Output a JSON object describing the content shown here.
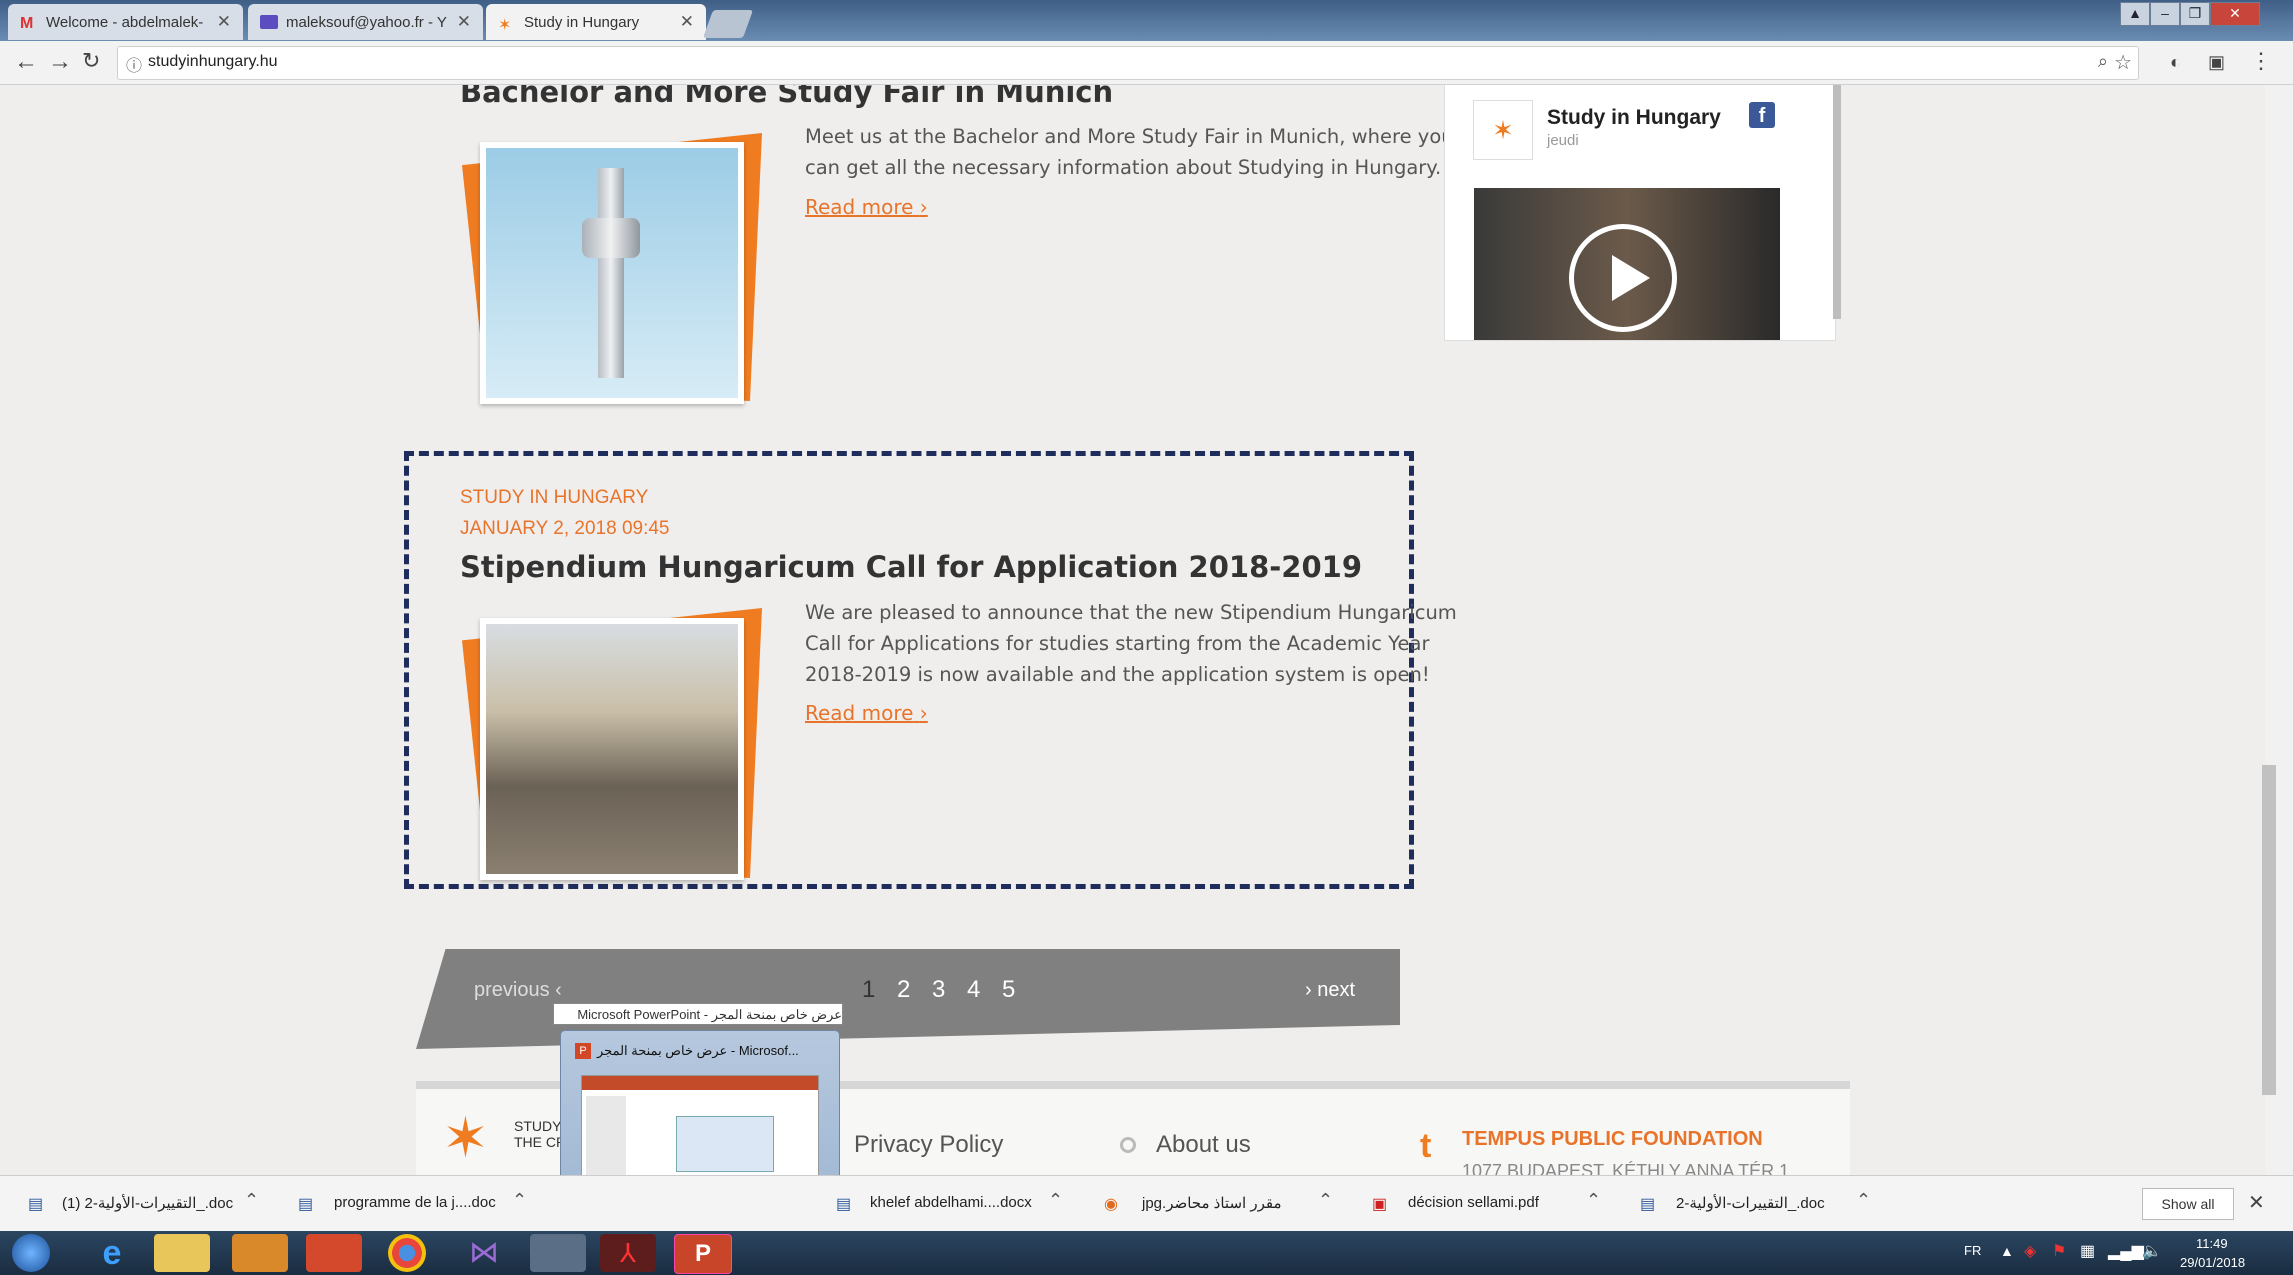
{
  "browser": {
    "tabs": [
      {
        "label": "Welcome - abdelmalek-",
        "icon": "gmail-icon"
      },
      {
        "label": "maleksouf@yahoo.fr - Y",
        "icon": "yahoo-mail-icon"
      },
      {
        "label": "Study in Hungary",
        "icon": "site-icon"
      }
    ],
    "url": "studyinhungary.hu"
  },
  "articles": [
    {
      "title": "Bachelor and More Study Fair in Munich",
      "excerpt_lines": [
        "Meet us at the Bachelor and More Study Fair in Munich, where you",
        "can get all the necessary information about Studying in Hungary."
      ],
      "read_more": "Read more"
    },
    {
      "category": "STUDY IN HUNGARY",
      "date": "JANUARY 2, 2018 09:45",
      "title": "Stipendium Hungaricum Call for Application 2018-2019",
      "excerpt_lines": [
        "We are pleased to announce that the new Stipendium Hungaricum",
        "Call for Applications for studies starting from the Academic Year",
        "2018-2019 is now available and the application system is open!"
      ],
      "read_more": "Read more"
    }
  ],
  "facebook_widget": {
    "page_name": "Study in Hungary",
    "subtitle": "jeudi"
  },
  "pagination": {
    "previous": "previous",
    "next": "next",
    "pages": [
      "1",
      "2",
      "3",
      "4",
      "5"
    ]
  },
  "footer": {
    "privacy": "Privacy Policy",
    "about": "About us",
    "logo_text_1": "STUDY",
    "logo_text_2": "THE CR",
    "tempus_title": "TEMPUS PUBLIC FOUNDATION",
    "tempus_address": "1077 BUDAPEST, KÉTHLY ANNA TÉR 1"
  },
  "thumbnail_popup": {
    "tooltip": "عرض خاص بمنحة المجر - Microsoft PowerPoint",
    "title": "عرض خاص بمنحة المجر - Microsof..."
  },
  "downloads": [
    {
      "name": "(1) التقييرات-الأولية-2_.doc"
    },
    {
      "name": "programme de la j....doc"
    },
    {
      "name": "khelef abdelhami....docx"
    },
    {
      "name": "مقرر استاذ محاضر.jpg"
    },
    {
      "name": "décision sellami.pdf"
    },
    {
      "name": "التقييرات-الأولية-2_.doc"
    }
  ],
  "downloads_show_all": "Show all",
  "taskbar": {
    "lang": "FR",
    "time": "11:49",
    "date": "29/01/2018"
  },
  "colors": {
    "accent": "#e8742b",
    "frame": "#f07c22",
    "dash": "#1f2d5c"
  }
}
